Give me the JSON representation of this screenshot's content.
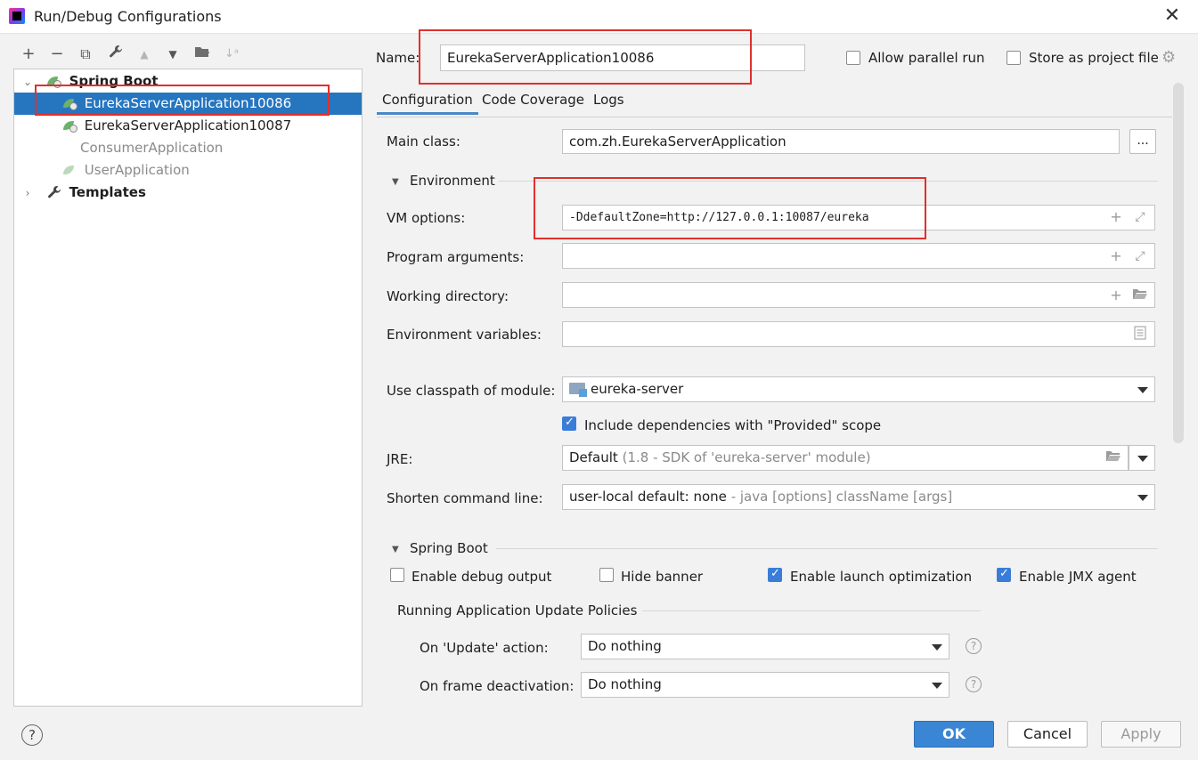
{
  "window": {
    "title": "Run/Debug Configurations",
    "close": "✕"
  },
  "toolbar": {
    "add": "+",
    "remove": "−",
    "copy": "⧉",
    "edit": "🔧",
    "up": "▲",
    "down": "▼",
    "folder": "📁",
    "sort": "↓ᵃ"
  },
  "tree": {
    "group_label": "Spring Boot",
    "items": [
      {
        "label": "EurekaServerApplication10086",
        "selected": true
      },
      {
        "label": "EurekaServerApplication10087",
        "selected": false
      },
      {
        "label": "ConsumerApplication",
        "selected": false
      },
      {
        "label": "UserApplication",
        "selected": false
      }
    ],
    "templates_label": "Templates"
  },
  "header": {
    "name_label": "Name:",
    "name_value": "EurekaServerApplication10086",
    "allow_parallel_label": "Allow parallel run",
    "allow_parallel_checked": false,
    "store_as_project_label": "Store as project file",
    "store_as_project_checked": false
  },
  "tabs": [
    {
      "label": "Configuration",
      "active": true
    },
    {
      "label": "Code Coverage",
      "active": false
    },
    {
      "label": "Logs",
      "active": false
    }
  ],
  "config": {
    "main_class_label": "Main class:",
    "main_class_value": "com.zh.EurekaServerApplication",
    "browse_btn": "...",
    "environment_section": "Environment",
    "vm_options_label": "VM options:",
    "vm_options_value": "-DdefaultZone=http://127.0.0.1:10087/eureka",
    "program_args_label": "Program arguments:",
    "program_args_value": "",
    "working_dir_label": "Working directory:",
    "working_dir_value": "",
    "env_vars_label": "Environment variables:",
    "env_vars_value": "",
    "classpath_label": "Use classpath of module:",
    "classpath_value": "eureka-server",
    "include_provided_label": "Include dependencies with \"Provided\" scope",
    "include_provided_checked": true,
    "jre_label": "JRE:",
    "jre_value_main": "Default",
    "jre_value_detail": "(1.8 - SDK of 'eureka-server' module)",
    "shorten_label": "Shorten command line:",
    "shorten_value_main": "user-local default: none",
    "shorten_value_detail": "- java [options] className [args]",
    "spring_boot_section": "Spring Boot",
    "enable_debug_label": "Enable debug output",
    "enable_debug_checked": false,
    "hide_banner_label": "Hide banner",
    "hide_banner_checked": false,
    "launch_opt_label": "Enable launch optimization",
    "launch_opt_checked": true,
    "jmx_label": "Enable JMX agent",
    "jmx_checked": true,
    "policies_title": "Running Application Update Policies",
    "on_update_label": "On 'Update' action:",
    "on_update_value": "Do nothing",
    "on_frame_label": "On frame deactivation:",
    "on_frame_value": "Do nothing"
  },
  "footer": {
    "help": "?",
    "ok": "OK",
    "cancel": "Cancel",
    "apply": "Apply"
  },
  "icons": {
    "plus": "+",
    "expand": "⤢",
    "folder_open": "📂",
    "list": "☰",
    "question": "?"
  },
  "colors": {
    "selection": "#2675bf",
    "annotation": "#e0302d",
    "accent": "#3a86d4"
  }
}
